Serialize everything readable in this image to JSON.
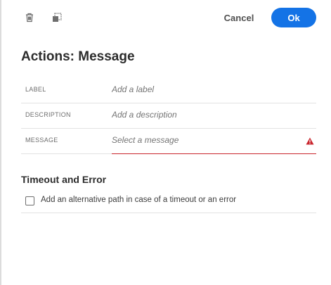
{
  "toolbar": {
    "cancel_label": "Cancel",
    "ok_label": "Ok",
    "delete_icon": "trash-icon",
    "duplicate_icon": "duplicate-icon"
  },
  "page": {
    "title": "Actions: Message"
  },
  "form": {
    "fields": [
      {
        "label": "LABEL",
        "placeholder": "Add a label",
        "value": ""
      },
      {
        "label": "DESCRIPTION",
        "placeholder": "Add a description",
        "value": ""
      },
      {
        "label": "MESSAGE",
        "placeholder": "Select a message",
        "value": "",
        "error": true
      }
    ]
  },
  "timeout": {
    "section_title": "Timeout and Error",
    "checkbox_label": "Add an alternative path in case of a timeout or an error",
    "checked": false
  },
  "colors": {
    "accent": "#1473e6",
    "error": "#c9252d"
  }
}
